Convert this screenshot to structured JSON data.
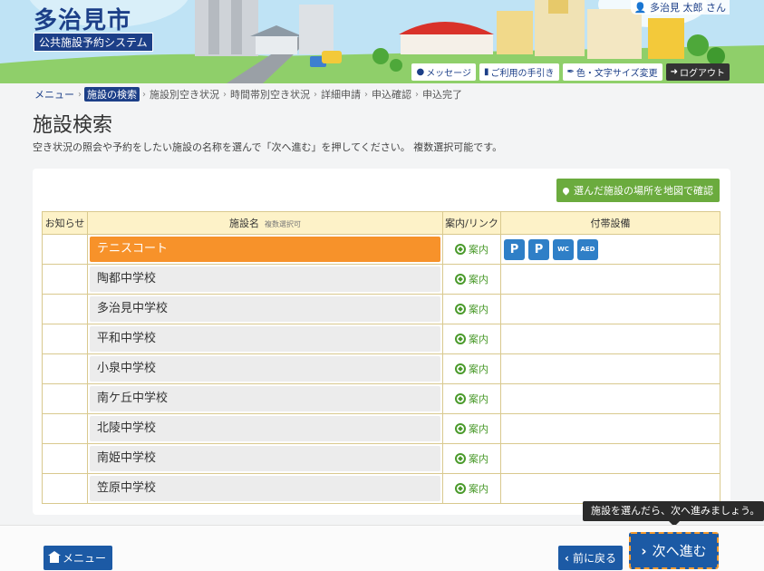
{
  "header": {
    "city_name": "多治見市",
    "system_name": "公共施設予約システム",
    "user_name": "多治見 太郎 さん",
    "buttons": [
      {
        "label": "メッセージ",
        "icon": "comment-icon"
      },
      {
        "label": "ご利用の手引き",
        "icon": "book-icon"
      },
      {
        "label": "色・文字サイズ変更",
        "icon": "brush-icon"
      },
      {
        "label": "ログアウト",
        "icon": "logout-icon"
      }
    ]
  },
  "breadcrumb": [
    {
      "label": "メニュー",
      "state": "link"
    },
    {
      "label": "施設の検索",
      "state": "active"
    },
    {
      "label": "施設別空き状況",
      "state": "pending"
    },
    {
      "label": "時間帯別空き状況",
      "state": "pending"
    },
    {
      "label": "詳細申請",
      "state": "pending"
    },
    {
      "label": "申込確認",
      "state": "pending"
    },
    {
      "label": "申込完了",
      "state": "pending"
    }
  ],
  "page": {
    "title": "施設検索",
    "description": "空き状況の照会や予約をしたい施設の名称を選んで「次へ進む」を押してください。 複数選択可能です。"
  },
  "map_button": "選んだ施設の場所を地図で確認",
  "table": {
    "headers": {
      "notice": "お知らせ",
      "name": "施設名",
      "name_sub": "複数選択可",
      "link": "案内/リンク",
      "equipment": "付帯設備"
    },
    "guide_label": "案内",
    "rows": [
      {
        "name": "テニスコート",
        "selected": true,
        "equipment": true
      },
      {
        "name": "陶都中学校",
        "selected": false,
        "equipment": false
      },
      {
        "name": "多治見中学校",
        "selected": false,
        "equipment": false
      },
      {
        "name": "平和中学校",
        "selected": false,
        "equipment": false
      },
      {
        "name": "小泉中学校",
        "selected": false,
        "equipment": false
      },
      {
        "name": "南ケ丘中学校",
        "selected": false,
        "equipment": false
      },
      {
        "name": "北陵中学校",
        "selected": false,
        "equipment": false
      },
      {
        "name": "南姫中学校",
        "selected": false,
        "equipment": false
      },
      {
        "name": "笠原中学校",
        "selected": false,
        "equipment": false
      }
    ],
    "equipment_icons": [
      {
        "icon": "parking-icon",
        "text": "P"
      },
      {
        "icon": "accessible-parking-icon",
        "text": "P"
      },
      {
        "icon": "accessible-toilet-icon",
        "text": "WC"
      },
      {
        "icon": "aed-icon",
        "text": "AED"
      }
    ]
  },
  "footer": {
    "menu_label": "メニュー",
    "back_label": "前に戻る",
    "next_label": "次へ進む",
    "tooltip": "施設を選んだら、次へ進みましょう。"
  },
  "colors": {
    "primary": "#1c5aa5",
    "selected": "#f7922a",
    "map_button": "#6bab3e",
    "table_header": "#fdf2c8",
    "equipment_icon": "#2f7fc7"
  }
}
